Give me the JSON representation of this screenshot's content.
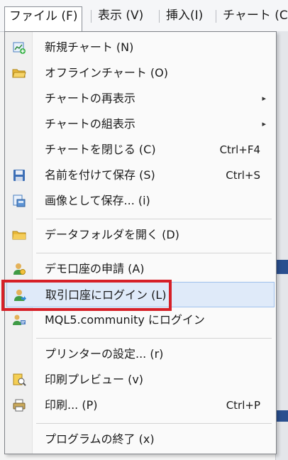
{
  "menubar": {
    "file": "ファイル (F)",
    "view": "表示 (V)",
    "insert": "挿入(I)",
    "chart": "チャート (C"
  },
  "menu": {
    "new_chart": "新規チャート (N)",
    "offline_chart": "オフラインチャート (O)",
    "redisplay": "チャートの再表示",
    "rearrange": "チャートの組表示",
    "close_chart": "チャートを閉じる (C)",
    "close_chart_shortcut": "Ctrl+F4",
    "save_as": "名前を付けて保存 (S)",
    "save_as_shortcut": "Ctrl+S",
    "save_image": "画像として保存... (i)",
    "open_data_folder": "データフォルダを開く (D)",
    "demo_account": "デモ口座の申請 (A)",
    "login_trade": "取引口座にログイン (L)",
    "mql5_login": "MQL5.community にログイン",
    "printer_setup": "プリンターの設定... (r)",
    "print_preview": "印刷プレビュー (v)",
    "print": "印刷... (P)",
    "print_shortcut": "Ctrl+P",
    "exit": "プログラムの終了 (x)"
  },
  "icons": {
    "new_chart": "new-chart-icon",
    "offline_chart": "folder-open-icon",
    "save_as": "floppy-disk-icon",
    "save_image": "image-save-icon",
    "open_data_folder": "folder-icon",
    "demo_account": "user-icon",
    "login_trade": "user-login-icon",
    "mql5_login": "community-icon",
    "print_preview": "print-preview-icon",
    "print": "printer-icon"
  },
  "colors": {
    "highlight_bg": "#dfeaf9",
    "highlight_border": "#9fc0ec",
    "callout": "#d62028"
  }
}
